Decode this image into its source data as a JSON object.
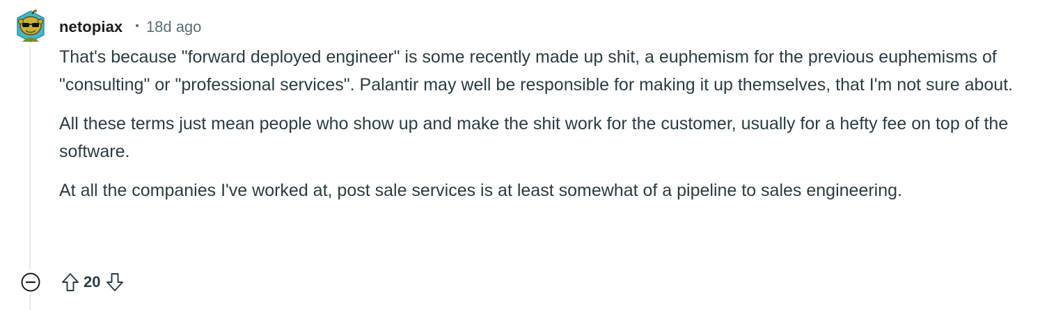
{
  "comment": {
    "author": "netopiax",
    "separator": "•",
    "timestamp": "18d ago",
    "paragraphs": [
      "That's because \"forward deployed engineer\" is some recently made up shit, a euphemism for the previous euphemisms of \"consulting\" or \"professional services\". Palantir may well be responsible for making it up themselves, that I'm not sure about.",
      "All these terms just mean people who show up and make the shit work for the customer, usually for a hefty fee on top of the software.",
      "At all the companies I've worked at, post sale services is at least somewhat of a pipeline to sales engineering."
    ],
    "score": "20",
    "avatar_icon": "snoo-avatar-icon",
    "icons": {
      "collapse": "collapse-minus-icon",
      "upvote": "upvote-arrow-icon",
      "downvote": "downvote-arrow-icon"
    }
  },
  "colors": {
    "text": "#2a3c42",
    "meta": "#576f76",
    "thread_line": "#e5ebee"
  }
}
